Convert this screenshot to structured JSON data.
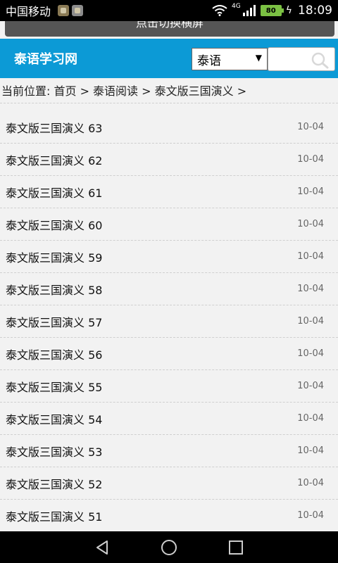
{
  "statusbar": {
    "carrier": "中国移动",
    "network": "4G",
    "battery": "80",
    "time": "18:09"
  },
  "toast": {
    "text": "点击切换横屏"
  },
  "header": {
    "site_title": "泰语学习网",
    "language_select": "泰语",
    "search_placeholder": ""
  },
  "breadcrumb": {
    "text": "当前位置: 首页 > 泰语阅读 > 泰文版三国演义 >"
  },
  "articles": [
    {
      "title": "泰文版三国演义 63",
      "date": "10-04"
    },
    {
      "title": "泰文版三国演义 62",
      "date": "10-04"
    },
    {
      "title": "泰文版三国演义 61",
      "date": "10-04"
    },
    {
      "title": "泰文版三国演义 60",
      "date": "10-04"
    },
    {
      "title": "泰文版三国演义 59",
      "date": "10-04"
    },
    {
      "title": "泰文版三国演义 58",
      "date": "10-04"
    },
    {
      "title": "泰文版三国演义 57",
      "date": "10-04"
    },
    {
      "title": "泰文版三国演义 56",
      "date": "10-04"
    },
    {
      "title": "泰文版三国演义 55",
      "date": "10-04"
    },
    {
      "title": "泰文版三国演义 54",
      "date": "10-04"
    },
    {
      "title": "泰文版三国演义 53",
      "date": "10-04"
    },
    {
      "title": "泰文版三国演义 52",
      "date": "10-04"
    },
    {
      "title": "泰文版三国演义 51",
      "date": "10-04"
    }
  ],
  "colors": {
    "header": "#0c9ad6",
    "background": "#f2f2f2"
  },
  "icons": {
    "nav": [
      "back-icon",
      "home-icon",
      "recents-icon"
    ]
  }
}
